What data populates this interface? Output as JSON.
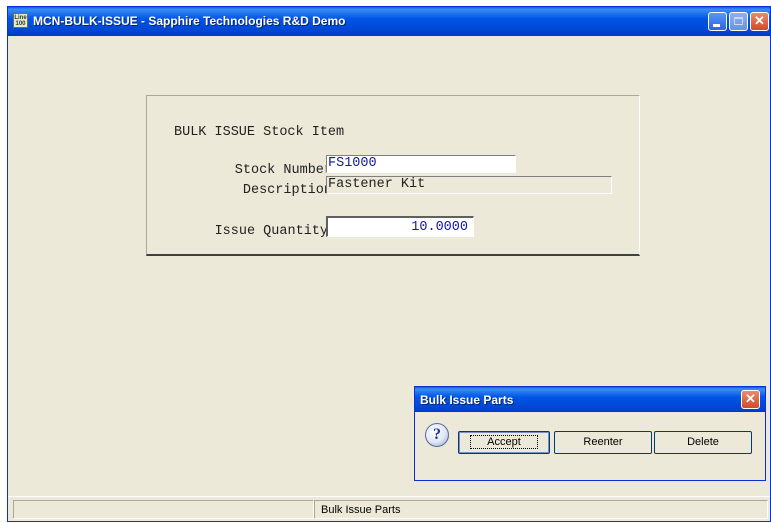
{
  "window": {
    "app_icon_text": "Line 100",
    "title": "MCN-BULK-ISSUE - Sapphire Technologies R&D Demo",
    "close_glyph": "✕"
  },
  "form": {
    "heading": "BULK ISSUE Stock Item",
    "stock_number_label": "Stock Number",
    "stock_number_value": "FS1000",
    "description_label": "Description",
    "description_value": "Fastener Kit",
    "issue_quantity_label": "Issue Quantity",
    "issue_quantity_value": "10.0000"
  },
  "statusbar": {
    "left_text": "",
    "message": "Bulk Issue Parts"
  },
  "dialog": {
    "title": "Bulk Issue Parts",
    "close_glyph": "✕",
    "icon_glyph": "?",
    "icon": "question-icon",
    "buttons": {
      "accept": "Accept",
      "reenter": "Reenter",
      "delete": "Delete"
    }
  },
  "colors": {
    "titlebar": "#0055e6",
    "window_bg": "#ece9d8",
    "field_text": "#1515a8"
  }
}
